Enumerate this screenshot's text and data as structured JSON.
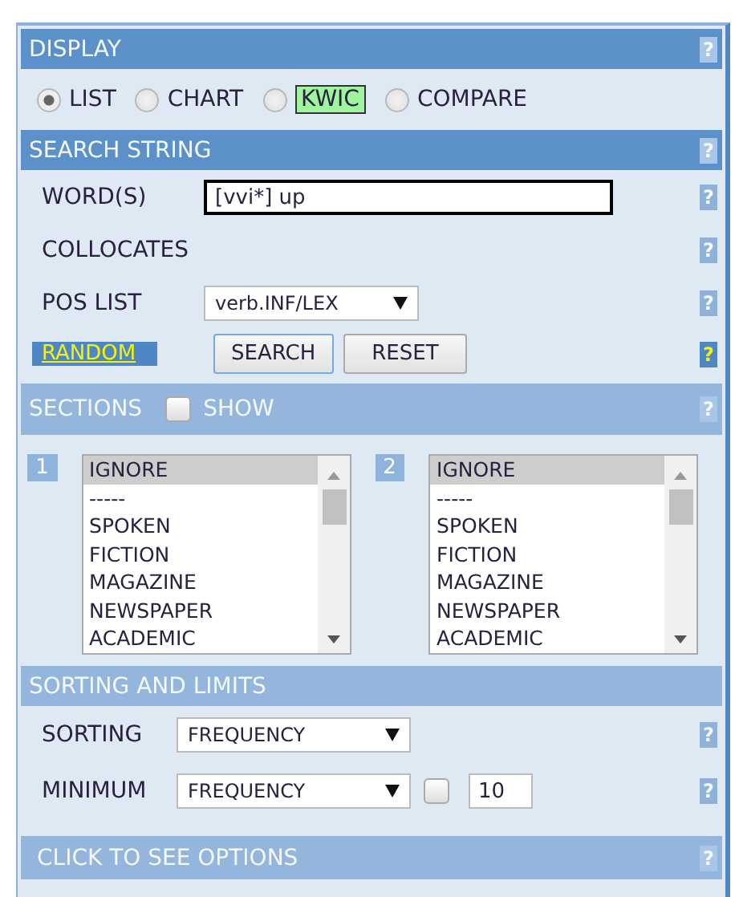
{
  "display": {
    "title": "DISPLAY",
    "help": "?",
    "active": true,
    "options": [
      {
        "label": "LIST",
        "selected": true,
        "highlighted": false
      },
      {
        "label": "CHART",
        "selected": false,
        "highlighted": false
      },
      {
        "label": "KWIC",
        "selected": false,
        "highlighted": true
      },
      {
        "label": "COMPARE",
        "selected": false,
        "highlighted": false
      }
    ]
  },
  "search_string": {
    "title": "SEARCH STRING",
    "help": "?",
    "active": true,
    "word": {
      "label": "WORD(S)",
      "value": "[vvi*] up",
      "help": "?"
    },
    "collocates": {
      "label": "COLLOCATES",
      "help": "?"
    },
    "pos_list": {
      "label": "POS LIST",
      "value": "verb.INF/LEX",
      "help": "?"
    },
    "random_link": "RANDOM",
    "buttons": [
      {
        "label": "SEARCH",
        "focused": true
      },
      {
        "label": "RESET",
        "focused": false
      }
    ],
    "random_help": {
      "text": "?",
      "highlighted": true
    }
  },
  "sections": {
    "title": "SECTIONS",
    "show_label": "SHOW",
    "show_checked": false,
    "help": "?",
    "active": false,
    "lists": [
      {
        "number": "1",
        "items": [
          {
            "label": "IGNORE",
            "selected": true
          },
          {
            "label": "-----",
            "selected": false
          },
          {
            "label": "SPOKEN",
            "selected": false
          },
          {
            "label": "FICTION",
            "selected": false
          },
          {
            "label": "MAGAZINE",
            "selected": false
          },
          {
            "label": "NEWSPAPER",
            "selected": false
          },
          {
            "label": "ACADEMIC",
            "selected": false
          }
        ]
      },
      {
        "number": "2",
        "items": [
          {
            "label": "IGNORE",
            "selected": true
          },
          {
            "label": "-----",
            "selected": false
          },
          {
            "label": "SPOKEN",
            "selected": false
          },
          {
            "label": "FICTION",
            "selected": false
          },
          {
            "label": "MAGAZINE",
            "selected": false
          },
          {
            "label": "NEWSPAPER",
            "selected": false
          },
          {
            "label": "ACADEMIC",
            "selected": false
          }
        ]
      }
    ]
  },
  "sorting": {
    "title": "SORTING AND LIMITS",
    "active": false,
    "sorting": {
      "label": "SORTING",
      "value": "FREQUENCY",
      "help": "?"
    },
    "minimum": {
      "label": "MINIMUM",
      "value": "FREQUENCY",
      "checked": false,
      "amount": "10",
      "help": "?"
    }
  },
  "options": {
    "title": "CLICK TO SEE OPTIONS",
    "help": "?",
    "active": false
  }
}
